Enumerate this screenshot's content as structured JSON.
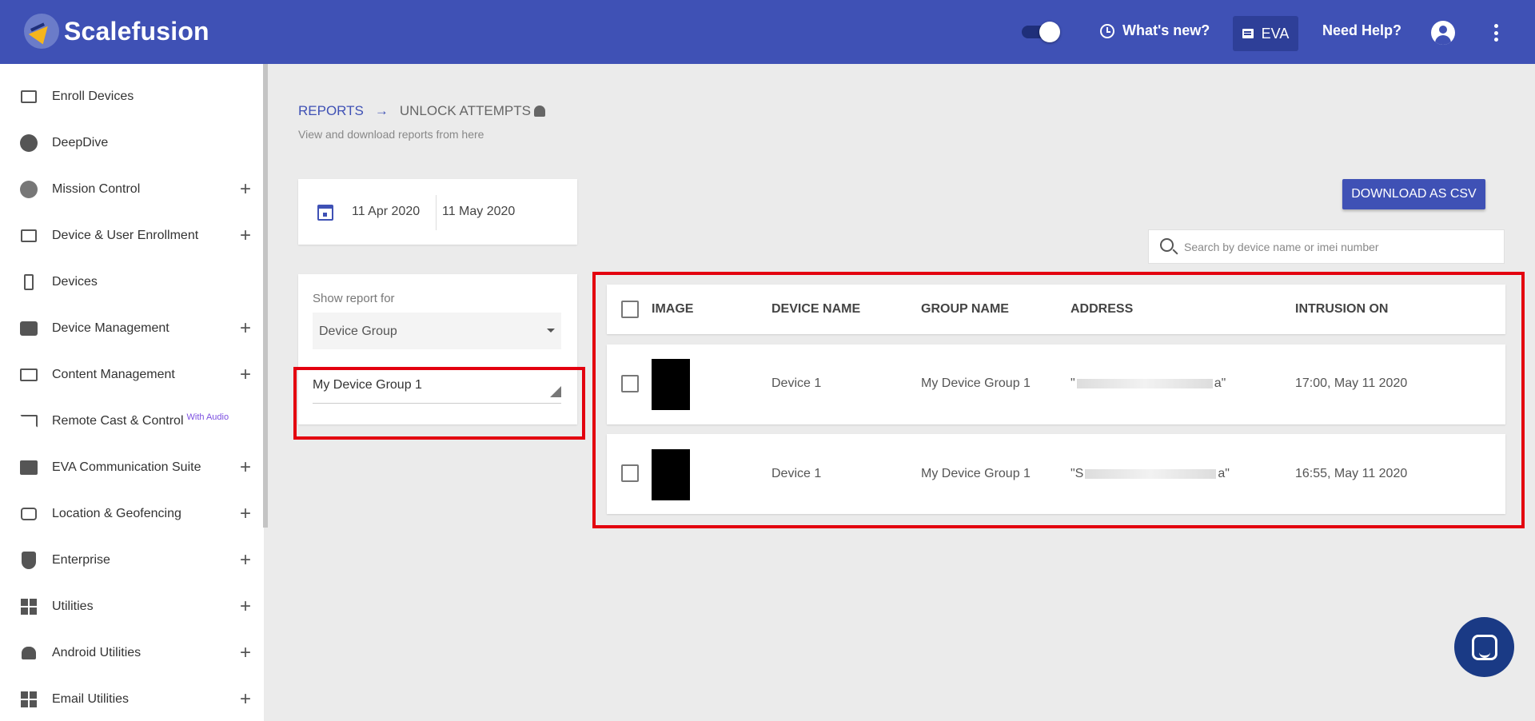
{
  "app": {
    "brand": "Scalefusion"
  },
  "topbar": {
    "whats_new": "What's new?",
    "eva": "EVA",
    "need_help": "Need Help?"
  },
  "sidebar": {
    "items": [
      {
        "label": "Enroll Devices",
        "icon": "enroll-devices-icon",
        "expandable": false
      },
      {
        "label": "DeepDive",
        "icon": "dashboard-gauge-icon",
        "expandable": false
      },
      {
        "label": "Mission Control",
        "icon": "mission-control-icon",
        "expandable": true
      },
      {
        "label": "Device & User Enrollment",
        "icon": "device-enrollment-icon",
        "expandable": true
      },
      {
        "label": "Devices",
        "icon": "phone-icon",
        "expandable": false
      },
      {
        "label": "Device Management",
        "icon": "briefcase-icon",
        "expandable": true
      },
      {
        "label": "Content Management",
        "icon": "folder-icon",
        "expandable": true
      },
      {
        "label": "Remote Cast & Control",
        "icon": "cast-icon",
        "expandable": false,
        "badge": "With Audio"
      },
      {
        "label": "EVA Communication Suite",
        "icon": "chat-icon",
        "expandable": true
      },
      {
        "label": "Location & Geofencing",
        "icon": "map-pin-icon",
        "expandable": true
      },
      {
        "label": "Enterprise",
        "icon": "shield-icon",
        "expandable": true
      },
      {
        "label": "Utilities",
        "icon": "widgets-icon",
        "expandable": true
      },
      {
        "label": "Android Utilities",
        "icon": "android-icon",
        "expandable": true
      },
      {
        "label": "Email Utilities",
        "icon": "widgets-icon",
        "expandable": true
      }
    ],
    "plus": "+"
  },
  "breadcrumb": {
    "parent": "REPORTS",
    "arrow": "→",
    "current": "UNLOCK ATTEMPTS",
    "subtitle": "View and download reports from here"
  },
  "date_range": {
    "start": "11 Apr 2020",
    "end": "11 May 2020"
  },
  "filter": {
    "label": "Show report for",
    "type_value": "Device Group",
    "group_value": "My Device Group 1"
  },
  "actions": {
    "download": "DOWNLOAD AS CSV"
  },
  "search": {
    "placeholder": "Search by device name or imei number"
  },
  "table": {
    "headers": [
      "IMAGE",
      "DEVICE NAME",
      "GROUP NAME",
      "ADDRESS",
      "INTRUSION ON"
    ],
    "rows": [
      {
        "device_name": "Device 1",
        "group_name": "My Device Group 1",
        "address_start": "\"",
        "address_end": "a\"",
        "intrusion_on": "17:00, May 11 2020"
      },
      {
        "device_name": "Device 1",
        "group_name": "My Device Group 1",
        "address_start": "\"S",
        "address_end": "a\"",
        "intrusion_on": "16:55, May 11 2020"
      }
    ]
  },
  "colors": {
    "primary": "#3f51b5",
    "highlight": "#e3000f",
    "fab": "#1a3a85"
  }
}
